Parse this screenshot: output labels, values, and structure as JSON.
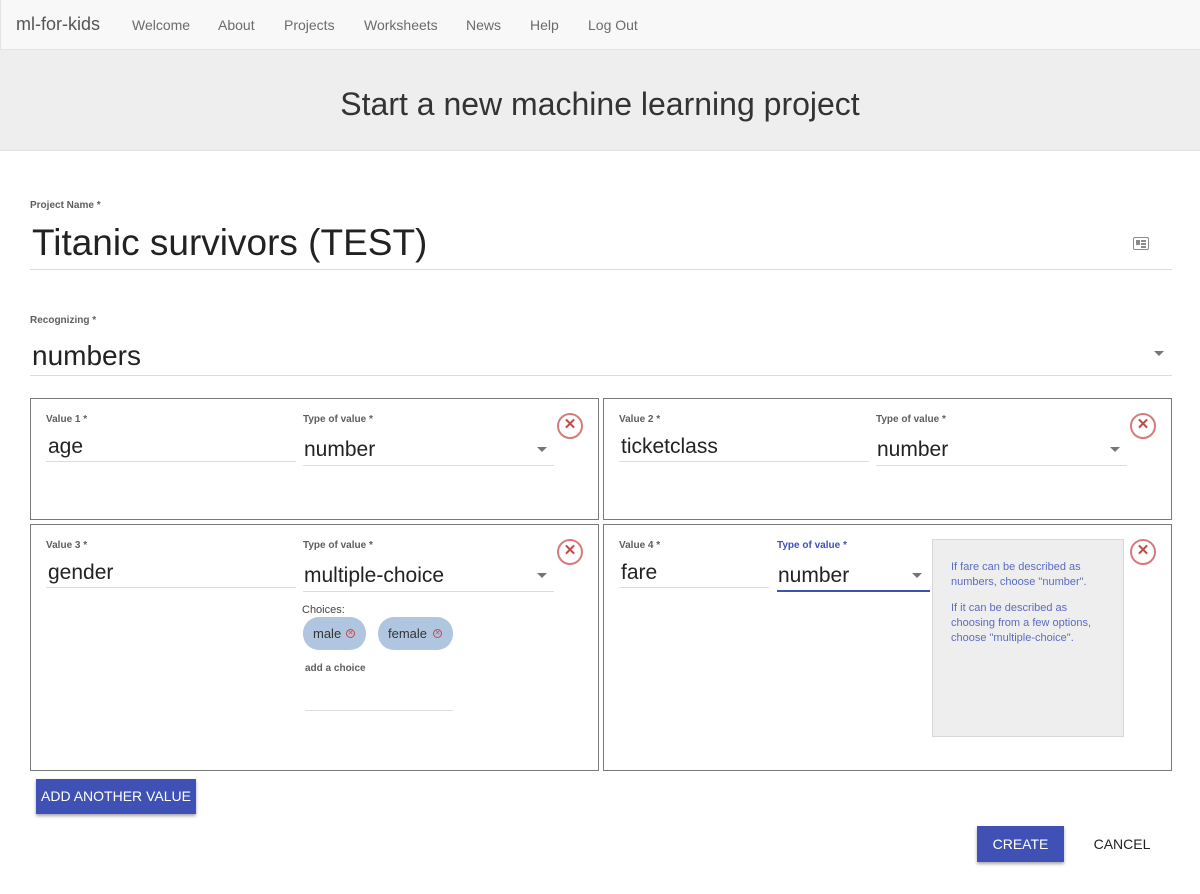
{
  "nav": {
    "brand": "ml-for-kids",
    "links": [
      "Welcome",
      "About",
      "Projects",
      "Worksheets",
      "News",
      "Help",
      "Log Out"
    ]
  },
  "banner": {
    "title": "Start a new machine learning project"
  },
  "form": {
    "project_name_label": "Project Name",
    "project_name_value": "Titanic survivors (TEST)",
    "recognizing_label": "Recognizing",
    "recognizing_value": "numbers",
    "required_marker": "*"
  },
  "values": [
    {
      "label": "Value 1",
      "name": "age",
      "type_label": "Type of value",
      "type": "number"
    },
    {
      "label": "Value 2",
      "name": "ticketclass",
      "type_label": "Type of value",
      "type": "number"
    },
    {
      "label": "Value 3",
      "name": "gender",
      "type_label": "Type of value",
      "type": "multiple-choice",
      "choices_label": "Choices:",
      "choices": [
        "male",
        "female"
      ],
      "add_choice_label": "add a choice"
    },
    {
      "label": "Value 4",
      "name": "fare",
      "type_label": "Type of value",
      "type": "number",
      "help": [
        "If fare can be described as numbers, choose \"number\".",
        "If it can be described as choosing from a few options, choose \"multiple-choice\"."
      ]
    }
  ],
  "remove_glyph": "✕",
  "chip_remove_glyph": "✕",
  "buttons": {
    "add_value": "ADD ANOTHER VALUE",
    "create": "CREATE",
    "cancel": "CANCEL"
  },
  "colors": {
    "primary": "#3f51b5",
    "remove": "#c24b4b",
    "chip": "#b0c6e0"
  }
}
